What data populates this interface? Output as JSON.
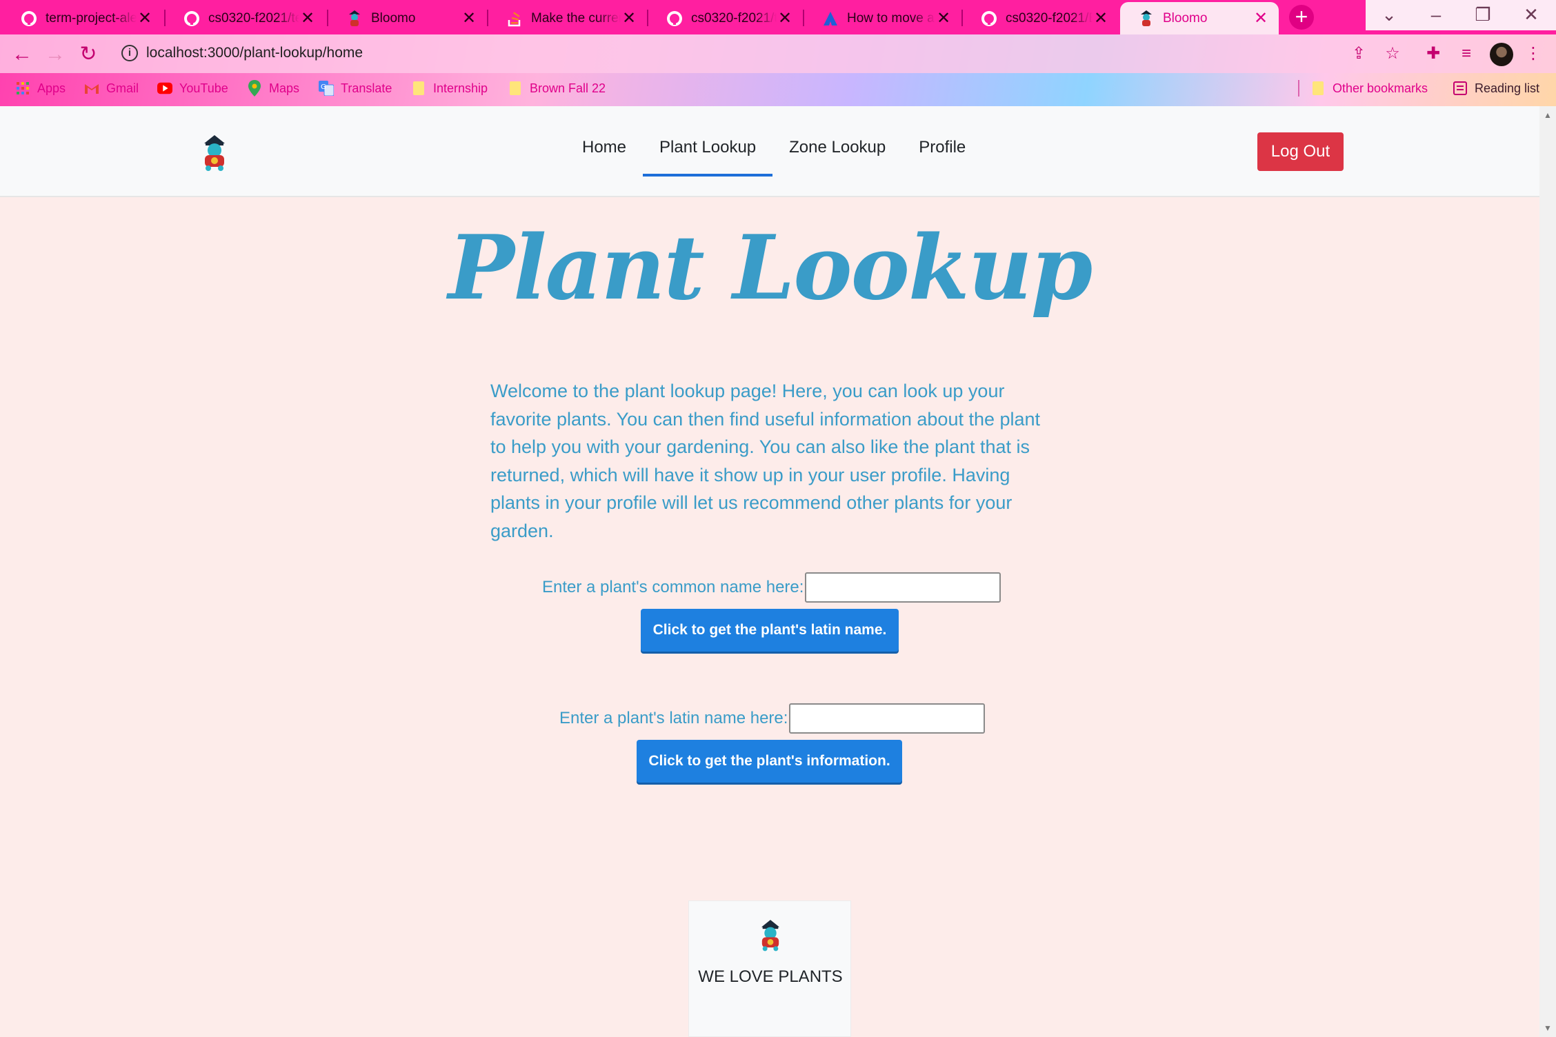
{
  "browser": {
    "tabs": [
      {
        "title": "term-project-ale",
        "favicon": "github-icon"
      },
      {
        "title": "cs0320-f2021/te",
        "favicon": "github-icon"
      },
      {
        "title": "Bloomo",
        "favicon": "bloomo-icon"
      },
      {
        "title": "Make the curren",
        "favicon": "stackoverflow-icon"
      },
      {
        "title": "cs0320-f2021/te",
        "favicon": "github-icon"
      },
      {
        "title": "How to move a",
        "favicon": "atlassian-icon"
      },
      {
        "title": "cs0320-f2021/Bl",
        "favicon": "github-icon"
      },
      {
        "title": "Bloomo",
        "favicon": "bloomo-icon",
        "active": true
      }
    ],
    "url": "localhost:3000/plant-lookup/home",
    "bookmarks": [
      {
        "label": "Apps",
        "icon": "apps-grid-icon"
      },
      {
        "label": "Gmail",
        "icon": "gmail-icon"
      },
      {
        "label": "YouTube",
        "icon": "youtube-icon"
      },
      {
        "label": "Maps",
        "icon": "maps-icon"
      },
      {
        "label": "Translate",
        "icon": "translate-icon"
      },
      {
        "label": "Internship",
        "icon": "folder-icon"
      },
      {
        "label": "Brown Fall 22",
        "icon": "folder-icon"
      }
    ],
    "other_bookmarks": "Other bookmarks",
    "reading_list": "Reading list",
    "accent": "#ff1fa0"
  },
  "navbar": {
    "links": [
      "Home",
      "Plant Lookup",
      "Zone Lookup",
      "Profile"
    ],
    "active_link": "Plant Lookup",
    "logout_label": "Log Out"
  },
  "main": {
    "title": "Plant Lookup",
    "intro": "Welcome to the plant lookup page! Here, you can look up your favorite plants. You can then find useful information about the plant to help you with your gardening. You can also like the plant that is returned, which will have it show up in your user profile. Having plants in your profile will let us recommend other plants for your garden.",
    "common_name_label": "Enter a plant's common name here:",
    "common_name_value": "",
    "common_name_button": "Click to get the plant's latin name.",
    "latin_name_label": "Enter a plant's latin name here:",
    "latin_name_value": "",
    "latin_name_button": "Click to get the plant's information."
  },
  "footer": {
    "text": "WE LOVE PLANTS"
  },
  "colors": {
    "page_bg": "#fdecea",
    "title_blue": "#3a9cc8",
    "button_blue": "#1e80e0",
    "logout_red": "#dc3545"
  }
}
